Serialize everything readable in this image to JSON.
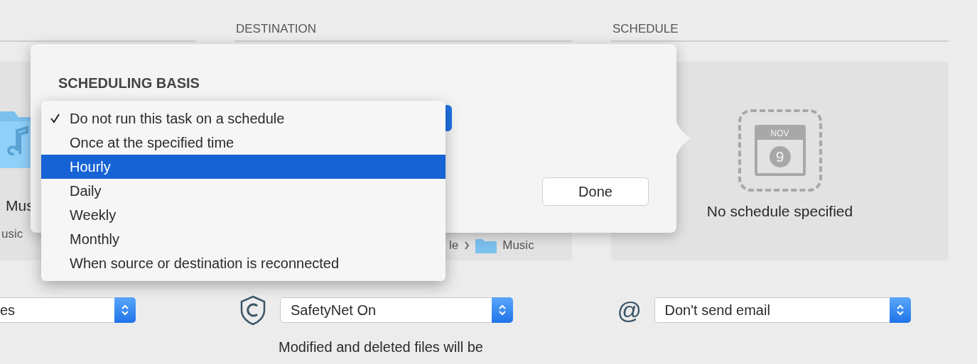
{
  "source": {
    "name_partial": "Mus",
    "path_partial": "usic",
    "popup": {
      "value": "es"
    }
  },
  "destination": {
    "header": "DESTINATION",
    "path_start": "le",
    "path_end": "Music",
    "safetynet": {
      "value": "SafetyNet On"
    },
    "note": "Modified and deleted files will be"
  },
  "schedule": {
    "header": "SCHEDULE",
    "calendar": {
      "month": "NOV",
      "day": "9"
    },
    "empty_text": "No schedule specified",
    "email": {
      "symbol": "@",
      "value": "Don't send email"
    }
  },
  "popover": {
    "title": "SCHEDULING BASIS",
    "done": "Done",
    "menu": [
      {
        "label": "Do not run this task on a schedule",
        "checked": true,
        "selected": false
      },
      {
        "label": "Once at the specified time",
        "checked": false,
        "selected": false
      },
      {
        "label": "Hourly",
        "checked": false,
        "selected": true
      },
      {
        "label": "Daily",
        "checked": false,
        "selected": false
      },
      {
        "label": "Weekly",
        "checked": false,
        "selected": false
      },
      {
        "label": "Monthly",
        "checked": false,
        "selected": false
      },
      {
        "label": "When source or destination is reconnected",
        "checked": false,
        "selected": false
      }
    ]
  }
}
